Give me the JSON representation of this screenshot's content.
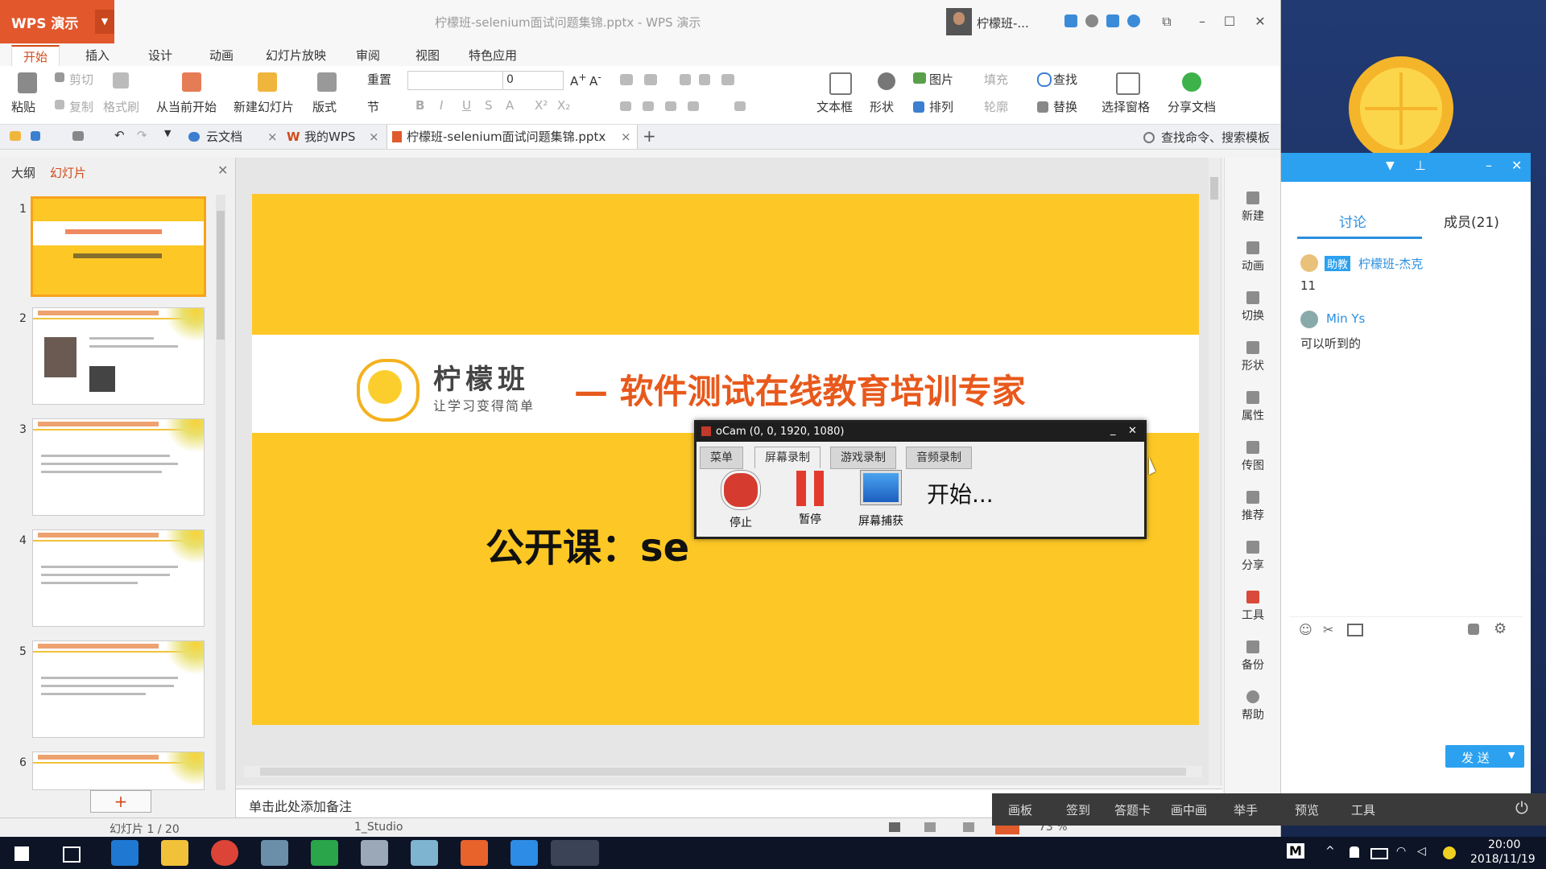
{
  "app": {
    "logo": "WPS 演示",
    "doc_title": "柠檬班-selenium面试问题集锦.pptx - WPS 演示",
    "user_name": "柠檬班-...",
    "colors": {
      "accent": "#d14b1b",
      "slide_bg": "#fdc825",
      "brand_orange": "#e8591c",
      "chat_blue": "#2ba1f0"
    }
  },
  "menu_tabs": [
    "开始",
    "插入",
    "设计",
    "动画",
    "幻灯片放映",
    "审阅",
    "视图",
    "特色应用"
  ],
  "ribbon": {
    "paste": "粘贴",
    "cut": "剪切",
    "copy": "复制",
    "format_painter": "格式刷",
    "from_current": "从当前开始",
    "new_slide": "新建幻灯片",
    "layout": "版式",
    "reset": "重置",
    "section": "节",
    "font_size": "0",
    "textbox": "文本框",
    "shape": "形状",
    "picture": "图片",
    "fill": "填充",
    "arrange": "排列",
    "outline": "轮廓",
    "find": "查找",
    "replace": "替换",
    "selection_pane": "选择窗格",
    "share_doc": "分享文档"
  },
  "doc_tabs": {
    "cloud": "云文档",
    "mywps": "我的WPS",
    "current": "柠檬班-selenium面试问题集锦.pptx",
    "find_cmd": "查找命令、搜索模板"
  },
  "left_panel": {
    "tab_outline": "大纲",
    "tab_slides": "幻灯片",
    "slide_numbers": [
      "1",
      "2",
      "3",
      "4",
      "5",
      "6"
    ]
  },
  "slide": {
    "brand": "柠檬班",
    "slogan": "让学习变得简单",
    "tagline": "— 软件测试在线教育培训专家",
    "course": "公开课：se"
  },
  "notes_placeholder": "单击此处添加备注",
  "right_toolbar": [
    "新建",
    "动画",
    "切换",
    "形状",
    "属性",
    "传图",
    "推荐",
    "分享",
    "工具",
    "备份",
    "帮助"
  ],
  "status_bar": {
    "slide_count": "幻灯片 1 / 20",
    "theme": "1_Studio",
    "zoom": "73 %"
  },
  "ocam": {
    "title": "oCam (0, 0, 1920, 1080)",
    "tabs": [
      "菜单",
      "屏幕录制",
      "游戏录制",
      "音频录制"
    ],
    "stop": "停止",
    "pause": "暂停",
    "capture": "屏幕捕获",
    "status": "开始..."
  },
  "chat": {
    "tab_discussion": "讨论",
    "tab_members": "成员(21)",
    "messages": [
      {
        "badge": "助教",
        "name": "柠檬班-杰克",
        "text": "11"
      },
      {
        "name": "Min Ys",
        "text": "可以听到的"
      }
    ],
    "send": "发 送"
  },
  "class_bar": [
    "画板",
    "签到",
    "答题卡",
    "画中画",
    "举手",
    "预览",
    "工具"
  ],
  "taskbar": {
    "time": "20:00",
    "date": "2018/11/19",
    "ime": "M"
  }
}
